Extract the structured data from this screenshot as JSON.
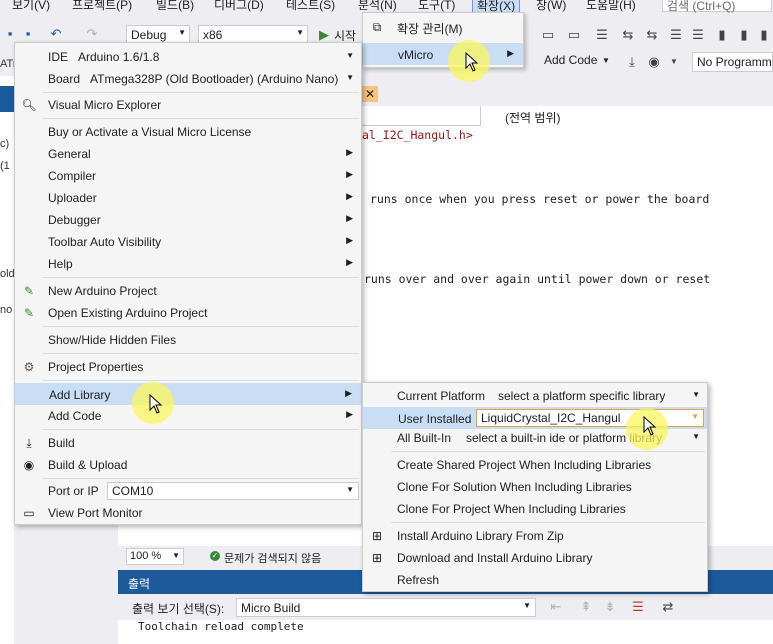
{
  "menubar": {
    "items": [
      {
        "label": "보기(V)",
        "active": false
      },
      {
        "label": "프로젝트(P)",
        "active": false
      },
      {
        "label": "빌드(B)",
        "active": false
      },
      {
        "label": "디버그(D)",
        "active": false
      },
      {
        "label": "테스트(S)",
        "active": false
      },
      {
        "label": "분석(N)",
        "active": false
      },
      {
        "label": "도구(T)",
        "active": false
      },
      {
        "label": "확장(X)",
        "active": true
      },
      {
        "label": "창(W)",
        "active": false
      },
      {
        "label": "도움말(H)",
        "active": false
      }
    ],
    "search_placeholder": "검색 (Ctrl+Q)"
  },
  "toolbar": {
    "config": "Debug",
    "platform": "x86",
    "start_label": "시작",
    "add_code": "Add Code",
    "programmer": "No Programme"
  },
  "extensions_menu": {
    "items": [
      {
        "label": "확장 관리(M)",
        "icon": "extensions-icon",
        "submenu": false
      },
      {
        "label": "vMicro",
        "icon": "",
        "submenu": true
      }
    ]
  },
  "vmicro_menu": {
    "ide_label": "IDE",
    "ide_value": "Arduino 1.6/1.8",
    "board_label": "Board",
    "board_value": "ATmega328P (Old Bootloader) (Arduino Nano)",
    "items_group1": [
      {
        "label": "Visual Micro Explorer",
        "icon": "search-icon",
        "submenu": false
      }
    ],
    "items_group2": [
      {
        "label": "Buy or Activate a Visual Micro License",
        "submenu": false
      },
      {
        "label": "General",
        "submenu": true
      },
      {
        "label": "Compiler",
        "submenu": true
      },
      {
        "label": "Uploader",
        "submenu": true
      },
      {
        "label": "Debugger",
        "submenu": true
      },
      {
        "label": "Toolbar Auto Visibility",
        "submenu": true
      },
      {
        "label": "Help",
        "submenu": true
      }
    ],
    "items_group3": [
      {
        "label": "New Arduino Project",
        "icon": "new-project-icon"
      },
      {
        "label": "Open Existing Arduino Project",
        "icon": "open-project-icon"
      }
    ],
    "show_hide": "Show/Hide Hidden Files",
    "project_properties": "Project Properties",
    "add_library": "Add Library",
    "add_code": "Add Code",
    "build": "Build",
    "build_upload": "Build & Upload",
    "port_label": "Port or IP",
    "port_value": "COM10",
    "view_port_monitor": "View Port Monitor"
  },
  "library_menu": {
    "current_platform_label": "Current Platform",
    "current_platform_value": "select a platform specific library",
    "user_installed_label": "User Installed",
    "user_installed_value": "LiquidCrystal_I2C_Hangul",
    "all_builtin_label": "All Built-In",
    "all_builtin_value": "select a built-in ide or platform library",
    "items": [
      "Create Shared Project When Including Libraries",
      "Clone For Solution When Including Libraries",
      "Clone For Project When Including Libraries"
    ],
    "install_zip": "Install Arduino Library From Zip",
    "download_install": "Download and Install Arduino Library",
    "refresh": "Refresh"
  },
  "editor": {
    "scope": "(전역 범위)",
    "include_line": "al_I2C_Hangul.h>",
    "comment_setup": "runs once when you press reset or power the board",
    "comment_loop": "runs over and over again until power down or reset",
    "left_fragments": [
      "ATr",
      "c)",
      "(1",
      "old",
      "no"
    ]
  },
  "status": {
    "zoom": "100 %",
    "issues": "문제가 검색되지 않음"
  },
  "output": {
    "title": "출력",
    "source_label": "출력 보기 선택(S):",
    "source_value": "Micro Build",
    "text": "Toolchain reload complete"
  },
  "colors": {
    "menu_bg": "#f5f5f5",
    "highlight": "#c9def5",
    "vs_blue": "#1c5a9c",
    "cursor_highlight": "#faf55a"
  }
}
